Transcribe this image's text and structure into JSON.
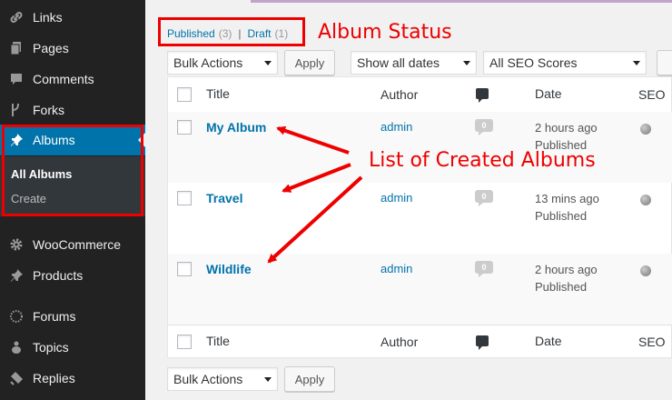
{
  "sidebar": {
    "items": [
      {
        "label": "Links",
        "icon": "link-icon"
      },
      {
        "label": "Pages",
        "icon": "pages-icon"
      },
      {
        "label": "Comments",
        "icon": "comment-icon"
      },
      {
        "label": "Forks",
        "icon": "fork-icon"
      },
      {
        "label": "Albums",
        "icon": "pin-icon",
        "active": true
      },
      {
        "label": "WooCommerce",
        "icon": "gear-icon"
      },
      {
        "label": "Products",
        "icon": "pin-icon"
      },
      {
        "label": "Forums",
        "icon": "forum-icon"
      },
      {
        "label": "Topics",
        "icon": "topics-icon"
      },
      {
        "label": "Replies",
        "icon": "reply-icon"
      }
    ],
    "submenu": [
      {
        "label": "All Albums",
        "current": true
      },
      {
        "label": "Create"
      }
    ]
  },
  "status": {
    "published_label": "Published",
    "published_count": "(3)",
    "separator": "|",
    "draft_label": "Draft",
    "draft_count": "(1)"
  },
  "annotations": {
    "album_status": "Album Status",
    "list_created": "List of Created Albums"
  },
  "filters": {
    "bulk_actions": "Bulk Actions",
    "apply": "Apply",
    "dates": "Show all dates",
    "seo_scores": "All SEO Scores"
  },
  "table": {
    "columns": {
      "title": "Title",
      "author": "Author",
      "date": "Date",
      "seo": "SEO"
    },
    "rows": [
      {
        "title": "My Album",
        "author": "admin",
        "comments": "0",
        "date_rel": "2 hours ago",
        "status": "Published"
      },
      {
        "title": "Travel",
        "author": "admin",
        "comments": "0",
        "date_rel": "13 mins ago",
        "status": "Published"
      },
      {
        "title": "Wildlife",
        "author": "admin",
        "comments": "0",
        "date_rel": "2 hours ago",
        "status": "Published"
      }
    ]
  },
  "colors": {
    "accent": "#0073aa",
    "annotation": "#ee0000",
    "sidebar": "#222222"
  }
}
